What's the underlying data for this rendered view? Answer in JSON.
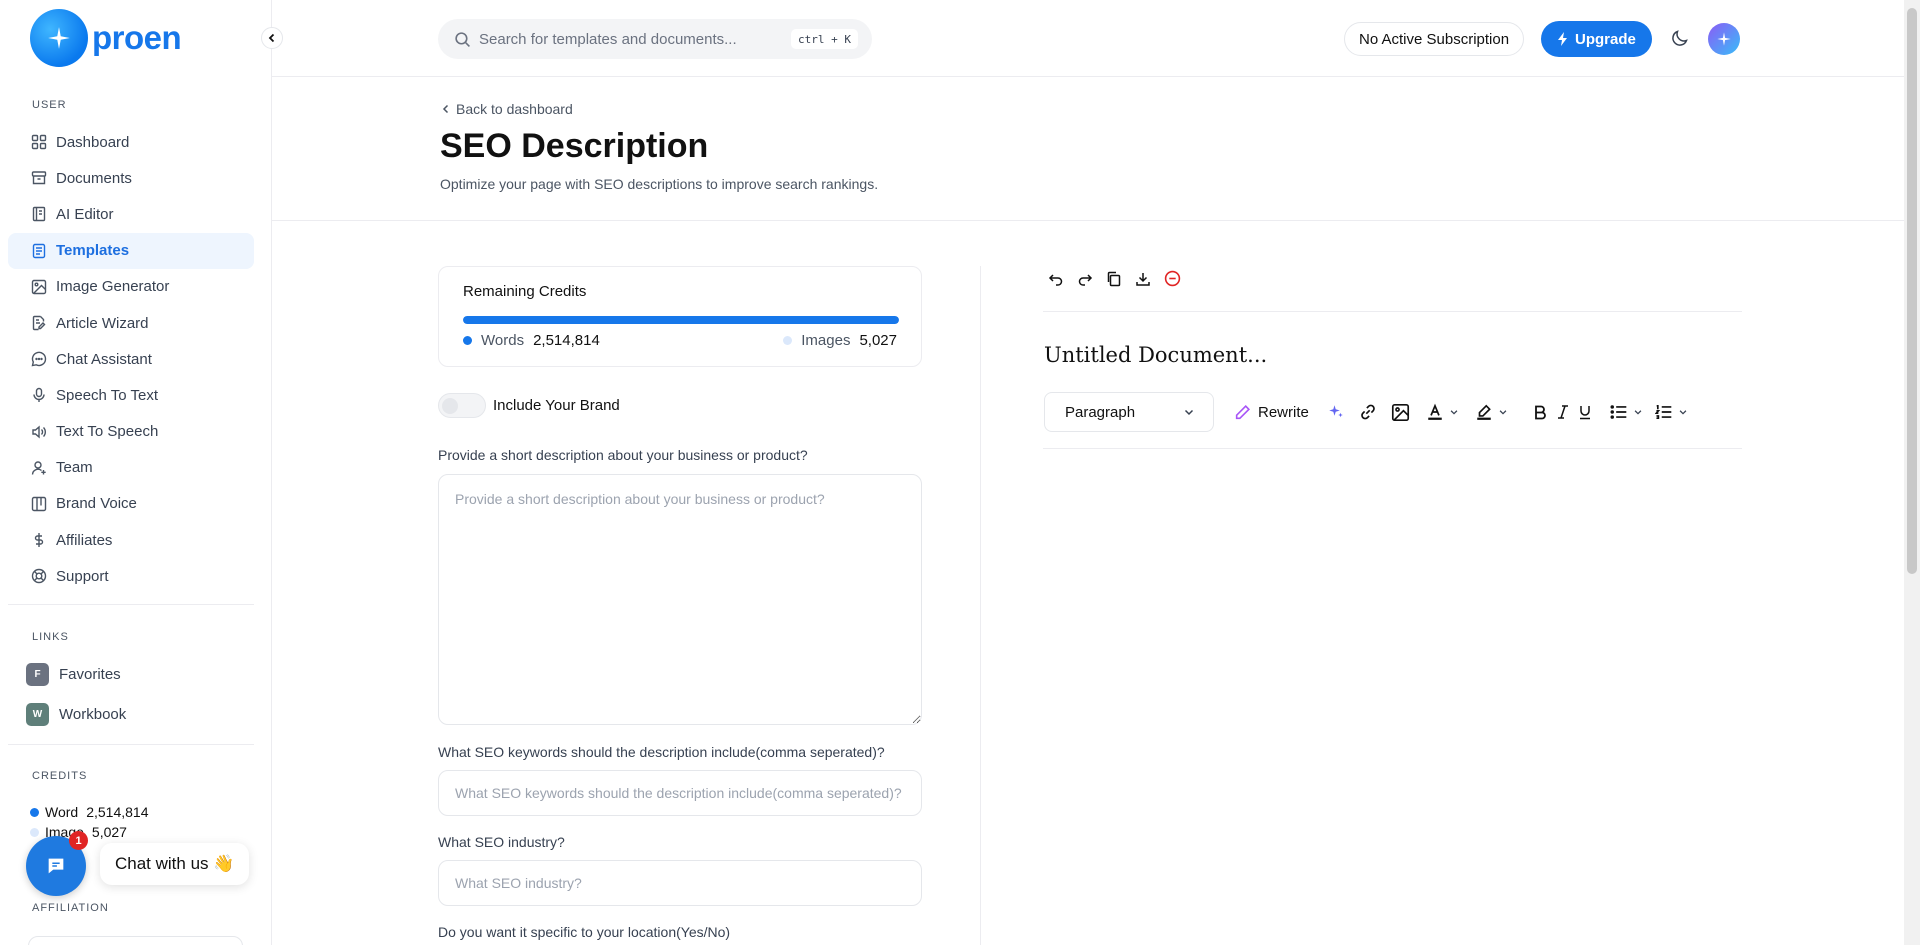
{
  "brand": {
    "name": "proen"
  },
  "sidebar": {
    "user_label": "USER",
    "items": [
      {
        "label": "Dashboard",
        "icon": "grid-icon"
      },
      {
        "label": "Documents",
        "icon": "archive-icon"
      },
      {
        "label": "AI Editor",
        "icon": "notebook-icon"
      },
      {
        "label": "Templates",
        "icon": "file-text-icon",
        "active": true
      },
      {
        "label": "Image Generator",
        "icon": "image-icon"
      },
      {
        "label": "Article Wizard",
        "icon": "file-edit-icon"
      },
      {
        "label": "Chat Assistant",
        "icon": "message-circle-icon"
      },
      {
        "label": "Speech To Text",
        "icon": "mic-icon"
      },
      {
        "label": "Text To Speech",
        "icon": "volume-icon"
      },
      {
        "label": "Team",
        "icon": "user-plus-icon"
      },
      {
        "label": "Brand Voice",
        "icon": "layout-icon"
      },
      {
        "label": "Affiliates",
        "icon": "dollar-icon"
      },
      {
        "label": "Support",
        "icon": "life-buoy-icon"
      }
    ],
    "links_label": "LINKS",
    "links": [
      {
        "badge": "F",
        "label": "Favorites",
        "color": "#6b7280"
      },
      {
        "badge": "W",
        "label": "Workbook",
        "color": "#5f7f7a"
      }
    ],
    "credits_label": "CREDITS",
    "credits": {
      "word_label": "Word",
      "word_value": "2,514,814",
      "image_label": "Image",
      "image_value": "5,027"
    },
    "affiliation_label": "AFFILIATION"
  },
  "chat": {
    "count": "1",
    "label": "Chat with us 👋"
  },
  "topbar": {
    "search_placeholder": "Search for templates and documents...",
    "shortcut": "ctrl + K",
    "subscription": "No Active Subscription",
    "upgrade": "Upgrade"
  },
  "header": {
    "back": "Back to dashboard",
    "title": "SEO Description",
    "description": "Optimize your page with SEO descriptions to improve search rankings."
  },
  "credits_card": {
    "label": "Remaining Credits",
    "words_label": "Words",
    "words_value": "2,514,814",
    "images_label": "Images",
    "images_value": "5,027",
    "words_fraction": 1.0
  },
  "form": {
    "brand_toggle": "Include Your Brand",
    "q1_label": "Provide a short description about your business or product?",
    "q1_placeholder": "Provide a short description about your business or product?",
    "q2_label": "What SEO keywords should the description include(comma seperated)?",
    "q2_placeholder": "What SEO keywords should the description include(comma seperated)?",
    "q3_label": "What SEO industry?",
    "q3_placeholder": "What SEO industry?",
    "q4_label": "Do you want it specific to your location(Yes/No)"
  },
  "editor": {
    "doc_title": "Untitled Document...",
    "paragraph": "Paragraph",
    "rewrite": "Rewrite"
  },
  "colors": {
    "accent": "#1677ea",
    "active_bg": "#eef5fe",
    "danger": "#e02424"
  }
}
